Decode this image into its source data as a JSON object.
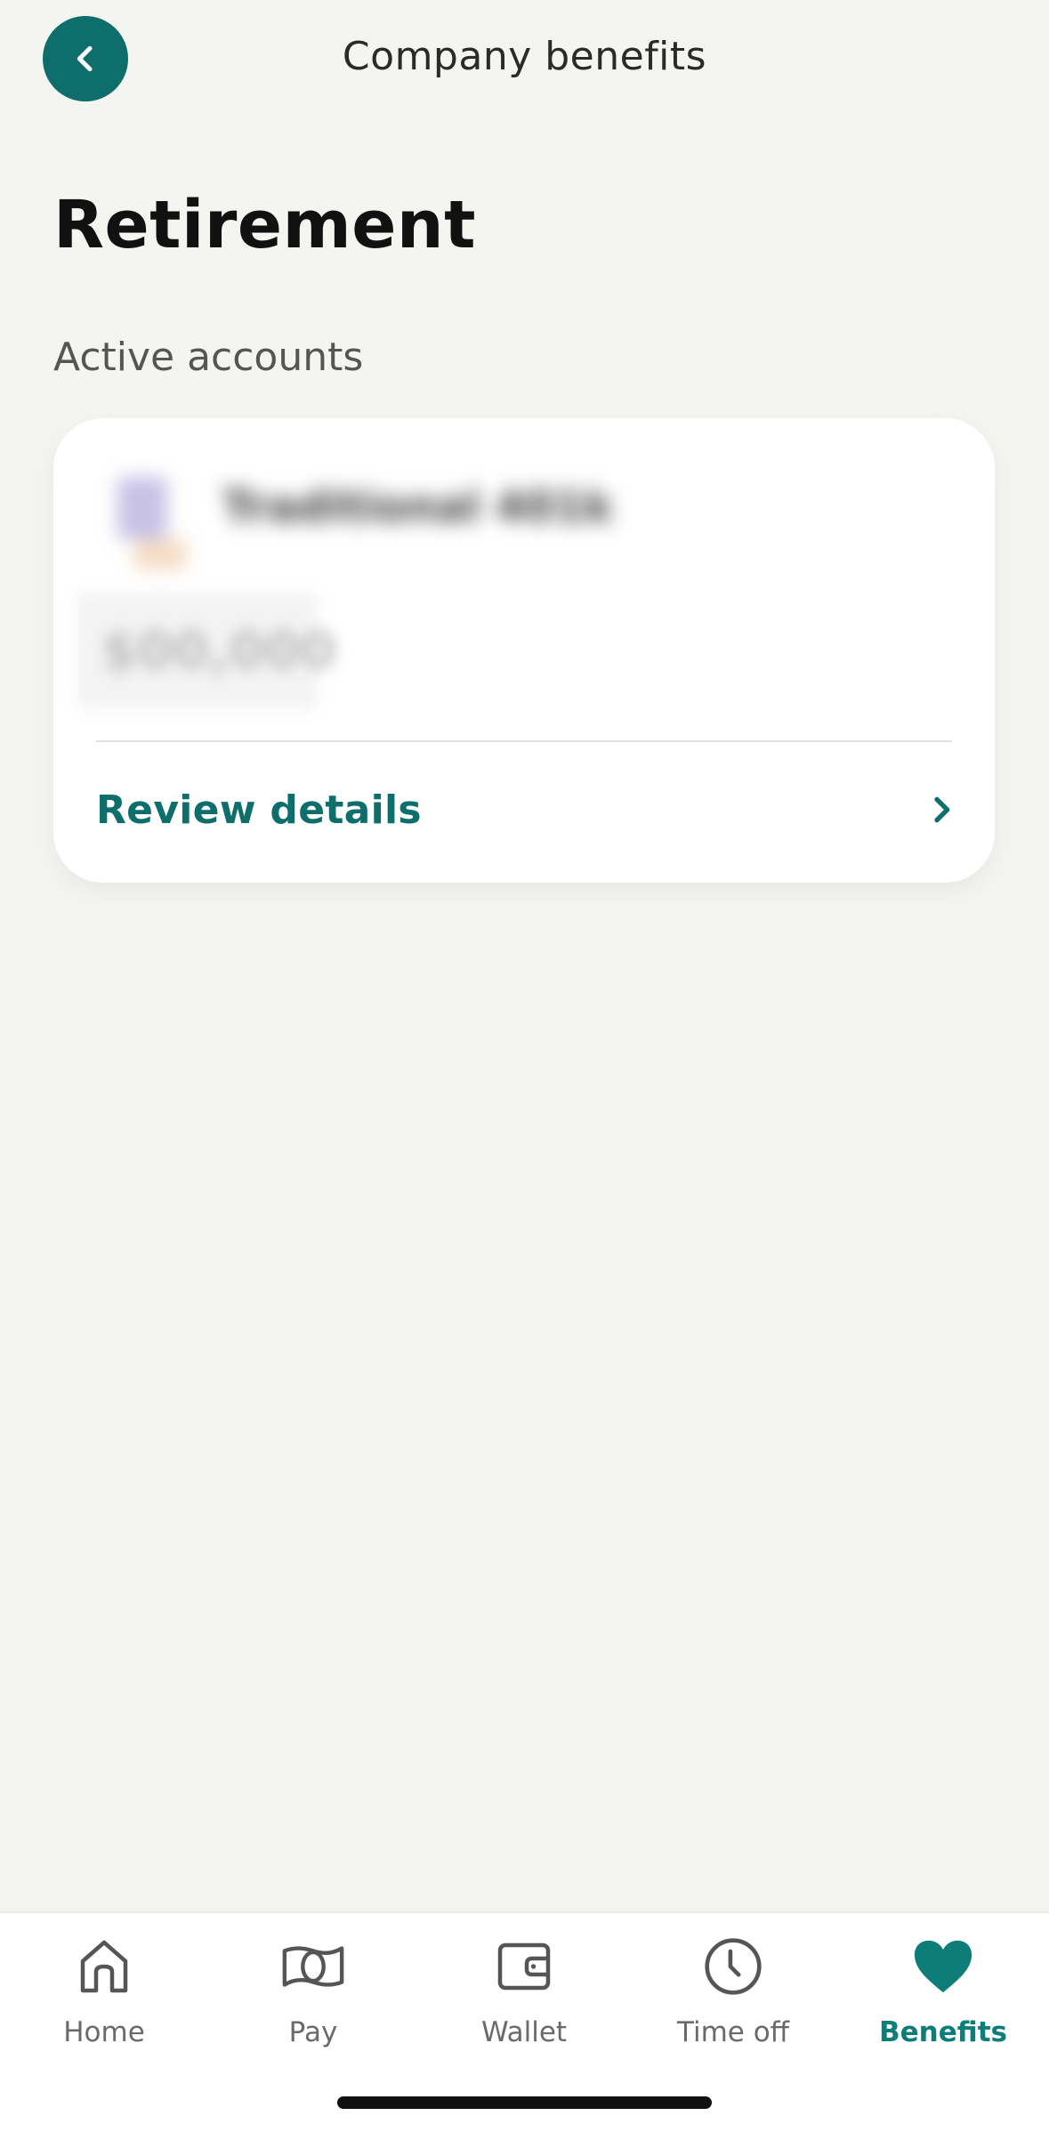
{
  "header": {
    "title": "Company benefits"
  },
  "page": {
    "title": "Retirement",
    "section_label": "Active accounts"
  },
  "account_card": {
    "plan_name": "Traditional 401k",
    "amount": "$00,000",
    "review_label": "Review details"
  },
  "bottom_nav": {
    "items": [
      {
        "label": "Home",
        "icon": "home-icon"
      },
      {
        "label": "Pay",
        "icon": "money-icon"
      },
      {
        "label": "Wallet",
        "icon": "wallet-icon"
      },
      {
        "label": "Time off",
        "icon": "clock-icon"
      },
      {
        "label": "Benefits",
        "icon": "heart-icon"
      }
    ],
    "active": "Benefits"
  },
  "colors": {
    "accent": "#0d6e6b",
    "accent_active": "#0d7d79",
    "background": "#f4f4f1",
    "card": "#ffffff"
  }
}
